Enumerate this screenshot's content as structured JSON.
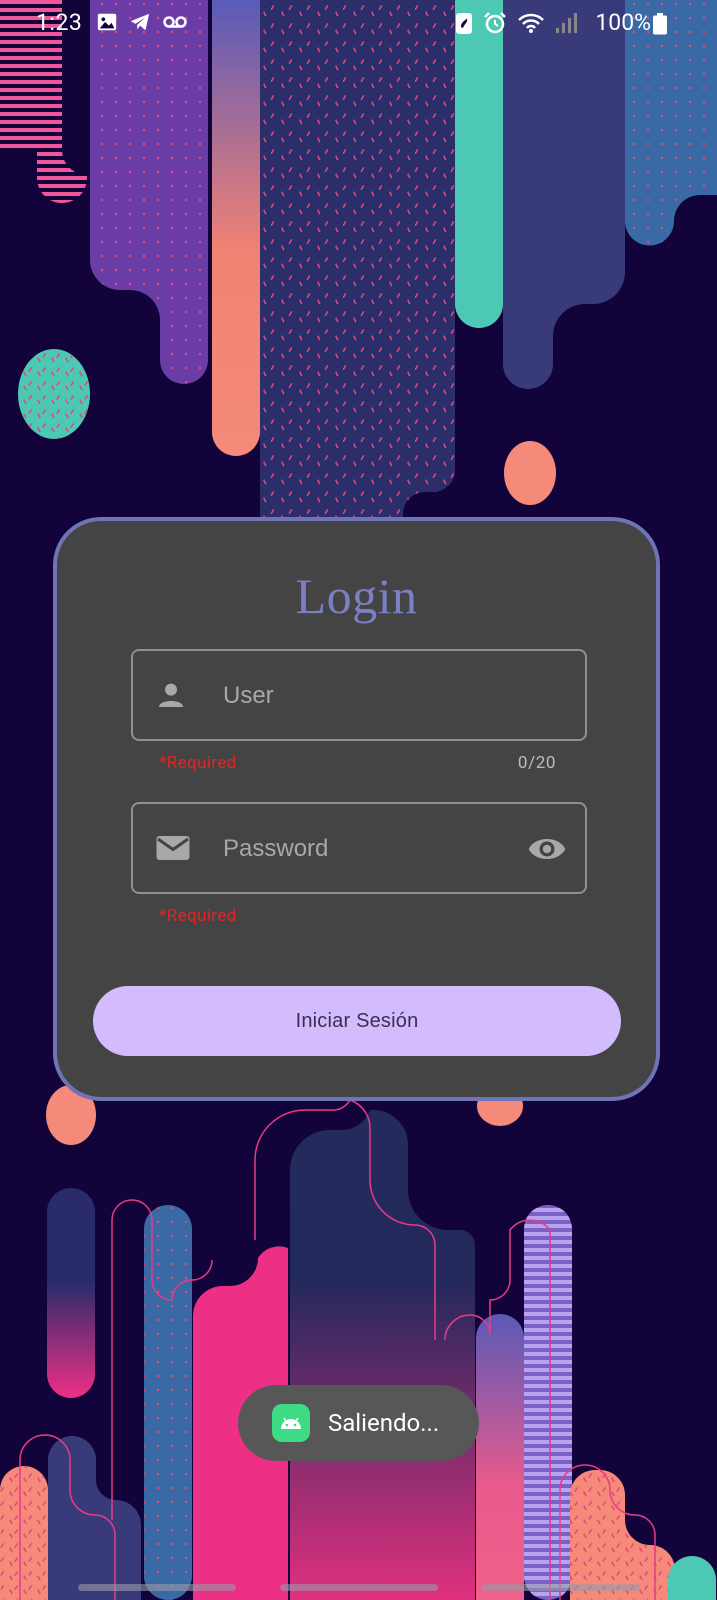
{
  "status_bar": {
    "time": "1:23",
    "battery_text": "100%",
    "left_icons": [
      "image-icon",
      "telegram-icon",
      "voicemail-icon"
    ],
    "right_icons": [
      "battery-saver-icon",
      "alarm-icon",
      "wifi-icon",
      "cellular-signal-icon",
      "battery-icon"
    ]
  },
  "login": {
    "title": "Login",
    "user_field": {
      "placeholder": "User",
      "value": "",
      "required_hint": "*Required",
      "counter": "0/20",
      "icon": "person-icon"
    },
    "password_field": {
      "placeholder": "Password",
      "value": "",
      "required_hint": "*Required",
      "icon": "mail-icon",
      "toggle_icon": "eye-icon"
    },
    "submit_label": "Iniciar Sesión"
  },
  "toast": {
    "text": "Saliendo...",
    "icon": "android-icon"
  },
  "colors": {
    "background": "#12043a",
    "card": "#444444",
    "card_border": "#6f73b8",
    "title": "#7b7fc6",
    "button": "#d3bcfd",
    "error": "#e02424"
  }
}
